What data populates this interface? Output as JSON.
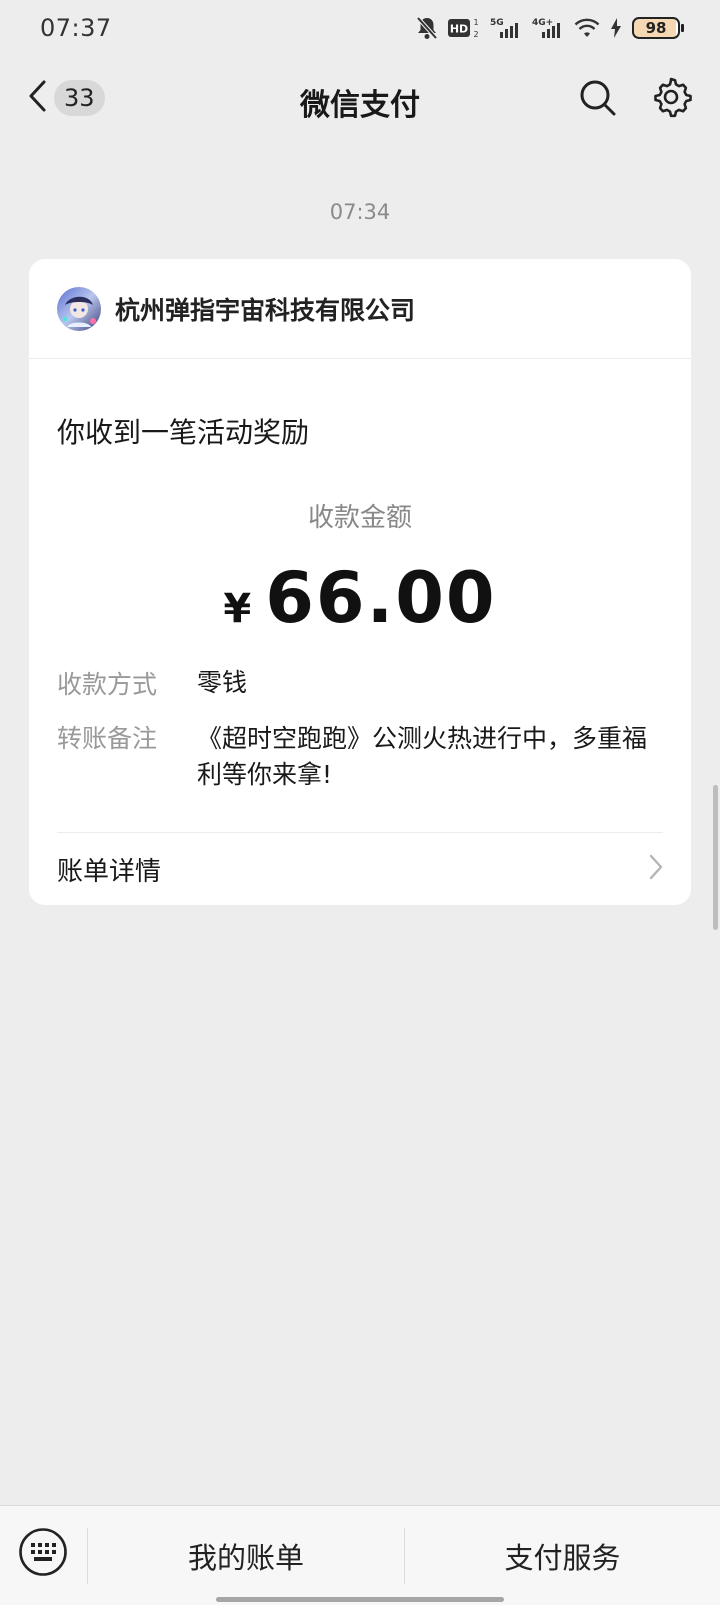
{
  "status_bar": {
    "time": "07:37",
    "battery": "98",
    "network_5g": "5G",
    "network_4g": "4G+",
    "hd_label": "HD"
  },
  "nav": {
    "unread_count": "33",
    "title": "微信支付"
  },
  "message": {
    "time": "07:34",
    "merchant_name": "杭州弹指宇宙科技有限公司",
    "headline": "你收到一笔活动奖励",
    "amount_label": "收款金额",
    "currency": "¥",
    "amount": "66.00",
    "method_label": "收款方式",
    "method_value": "零钱",
    "note_label": "转账备注",
    "note_value": "《超时空跑跑》公测火热进行中，多重福利等你来拿!",
    "bill_detail": "账单详情"
  },
  "bottom_bar": {
    "my_bill": "我的账单",
    "pay_service": "支付服务"
  },
  "colors": {
    "background": "#ededed",
    "card": "#ffffff",
    "text_primary": "#191919",
    "text_secondary": "#999999"
  }
}
